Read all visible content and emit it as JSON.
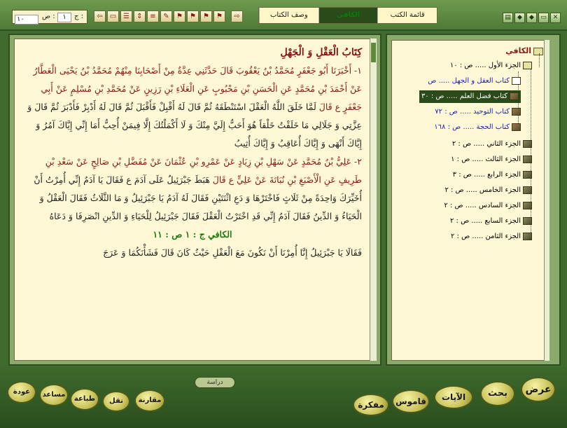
{
  "toolbar": {
    "page_label": "ص :",
    "page_value": "١٠",
    "part_label": "ج :",
    "part_value": "١",
    "buttons": [
      "⇦",
      "▭",
      "☰",
      "⇕",
      "≡",
      "✎",
      "⚑",
      "⚑",
      "⚑",
      "⚑",
      "⇨"
    ]
  },
  "tabs": [
    "قائمة الكتب",
    "الكافى",
    "وصف الكتاب"
  ],
  "text": {
    "title": "كِتَابُ الْعَقْلِ وَ الْجَهْلِ",
    "para1_red": "١- أَخْبَرَنَا أَبُو جَعْفَرٍ مُحَمَّدُ بْنُ يَعْقُوبَ قَالَ حَدَّثَنِي عِدَّةٌ مِنْ أَصْحَابِنَا مِنْهُمْ مُحَمَّدُ بْنُ يَحْيَى الْعَطَّارُ عَنْ أَحْمَدَ بْنِ مُحَمَّدٍ عَنِ الْحَسَنِ بْنِ مَحْبُوبٍ عَنِ الْعَلَاءِ بْنِ رَزِينٍ عَنْ مُحَمَّدِ بْنِ مُسْلِمٍ عَنْ أَبِي جَعْفَرٍ ع قَالَ",
    "para1_body": "لَمَّا خَلَقَ اللَّهُ الْعَقْلَ اسْتَنْطَقَهُ ثُمَّ قَالَ لَهُ أَقْبِلْ فَأَقْبَلَ ثُمَّ قَالَ لَهُ أَدْبِرْ فَأَدْبَرَ ثُمَّ قَالَ وَ عِزَّتِي وَ جَلَالِي مَا خَلَقْتُ خَلْقاً هُوَ أَحَبُّ إِلَيَّ مِنْكَ وَ لَا أَكْمَلْتُكَ إِلَّا فِيمَنْ أُحِبُّ أَمَا إِنِّي إِيَّاكَ آمُرُ وَ إِيَّاكَ أَنْهَى وَ إِيَّاكَ أُعَاقِبُ وَ إِيَّاكَ أُثِيبُ",
    "para2_red": "٢- عَلِيُّ بْنُ مُحَمَّدٍ عَنْ سَهْلِ بْنِ زِيَادٍ عَنْ عَمْرِو بْنِ عُثْمَانَ عَنْ مُفَضَّلِ بْنِ صَالِحٍ عَنْ سَعْدِ بْنِ طَرِيفٍ عَنِ الْأَصْبَغِ بْنِ نُبَاتَةَ عَنْ عَلِيٍّ ع قَالَ",
    "para2_body": "هَبَطَ جَبْرَئِيلُ عَلَى آدَمَ ع فَقَالَ يَا آدَمُ إِنِّي أُمِرْتُ أَنْ أُخَيِّرَكَ وَاحِدَةً مِنْ ثَلَاثٍ فَاخْتَرْهَا وَ دَعِ اثْنَتَيْنِ فَقَالَ لَهُ آدَمُ يَا جَبْرَئِيلُ وَ مَا الثَّلَاثُ فَقَالَ الْعَقْلُ وَ الْحَيَاءُ وَ الدِّينُ فَقَالَ آدَمُ إِنِّي قَدِ اخْتَرْتُ الْعَقْلَ فَقَالَ جَبْرَئِيلُ لِلْحَيَاءِ وَ الدِّينِ انْصَرِفَا وَ دَعَاهُ",
    "page_marker": "الكافي ج : ١ ص : ١١",
    "para3_body": "فَقَالَا يَا جَبْرَئِيلُ إِنَّا أُمِرْنَا أَنْ نَكُونَ مَعَ الْعَقْلِ حَيْثُ كَانَ قَالَ فَشَأْنَكُمَا وَ عَرَجَ"
  },
  "tree": {
    "root": "الكافي",
    "items": [
      {
        "label": "الجزء الأول ..... ص : ١٠",
        "level": "vol"
      },
      {
        "label": "كتاب العقل و الجهل ..... ص",
        "level": "sub",
        "color": "blue"
      },
      {
        "label": "كتاب فضل العلم ..... ص : ٣٠",
        "level": "sub",
        "selected": true
      },
      {
        "label": "كتاب التوحيد ..... ص : ٧٢",
        "level": "sub",
        "color": "blue"
      },
      {
        "label": "كتاب الحجة ..... ص : ١٦٨",
        "level": "sub",
        "color": "blue"
      },
      {
        "label": "الجزء الثاني ..... ص : ٢",
        "level": "vol"
      },
      {
        "label": "الجزء الثالث ..... ص : ١",
        "level": "vol"
      },
      {
        "label": "الجزء الرابع ..... ص : ٣",
        "level": "vol"
      },
      {
        "label": "الجزء الخامس ..... ص : ٢",
        "level": "vol"
      },
      {
        "label": "الجزء السادس ..... ص : ٢",
        "level": "vol"
      },
      {
        "label": "الجزء السابع ..... ص : ٢",
        "level": "vol"
      },
      {
        "label": "الجزء الثامن ..... ص : ٢",
        "level": "vol"
      }
    ]
  },
  "bottom": {
    "right": [
      "عرض",
      "بحث",
      "الآيات",
      "قاموس",
      "مفكرة"
    ],
    "left": [
      "عودة",
      "مساعد",
      "طباعة",
      "نقل",
      "مقارنة"
    ],
    "dirasa": "دراسة"
  }
}
